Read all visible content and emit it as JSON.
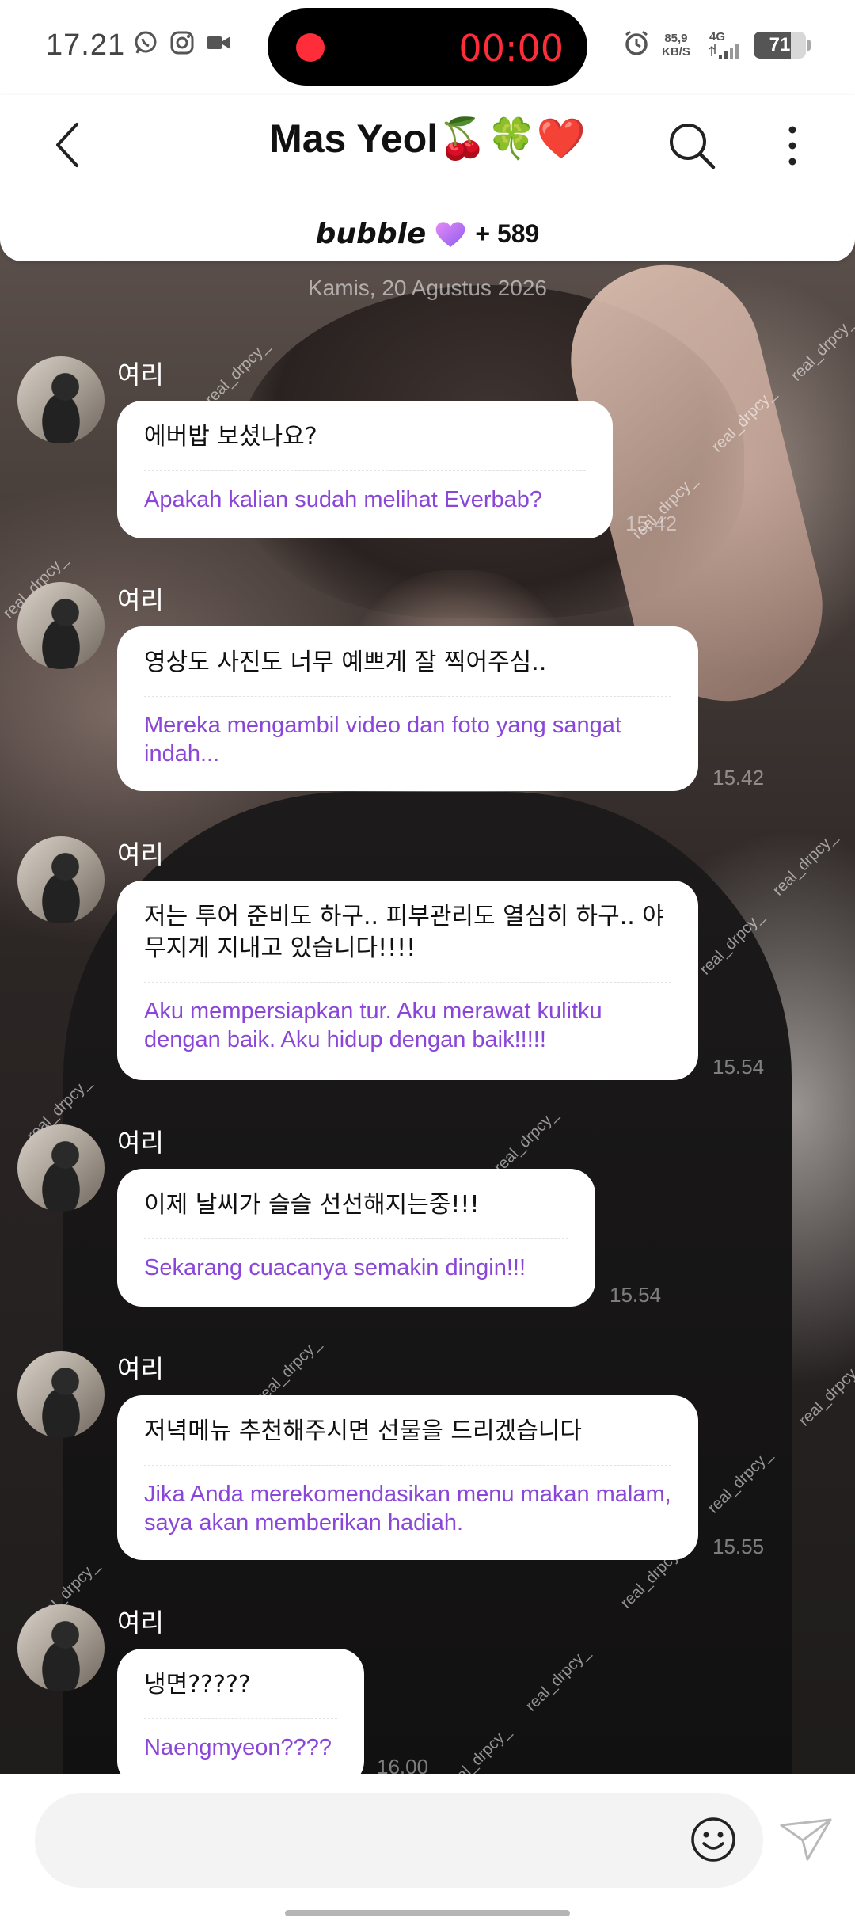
{
  "status_bar": {
    "time": "17.21",
    "record_time": "00:00",
    "net_speed_value": "85,9",
    "net_speed_unit": "KB/S",
    "signal": "4G",
    "battery": "71"
  },
  "header": {
    "title": "Mas Yeol🍒🍀❤️",
    "bubble_label": "bubble",
    "bubble_count": "+ 589"
  },
  "chat": {
    "date": "Kamis, 20 Agustus 2026",
    "messages": [
      {
        "sender": "여리",
        "korean": "에버밥 보셨나요?",
        "translation": "Apakah kalian sudah melihat Everbab?",
        "time": "15.42"
      },
      {
        "sender": "여리",
        "korean": "영상도 사진도 너무 예쁘게 잘 찍어주심..",
        "translation": "Mereka mengambil video dan foto yang sangat indah...",
        "time": "15.42"
      },
      {
        "sender": "여리",
        "korean": "저는 투어 준비도 하구.. 피부관리도 열심히 하구.. 야무지게 지내고 있습니다!!!!",
        "translation": "Aku mempersiapkan tur. Aku merawat kulitku dengan baik. Aku hidup dengan baik!!!!!",
        "time": "15.54"
      },
      {
        "sender": "여리",
        "korean": "이제 날씨가 슬슬 선선해지는중!!!",
        "translation": "Sekarang cuacanya semakin dingin!!!",
        "time": "15.54"
      },
      {
        "sender": "여리",
        "korean": "저녁메뉴 추천해주시면 선물을 드리겠습니다",
        "translation": "Jika Anda merekomendasikan menu makan malam, saya akan memberikan hadiah.",
        "time": "15.55"
      },
      {
        "sender": "여리",
        "korean": "냉면?????",
        "translation": "Naengmyeon????",
        "time": "16.00"
      }
    ],
    "watermark": "real_drpcy_"
  },
  "input": {
    "placeholder": "",
    "value": ""
  },
  "colors": {
    "translation": "#8a46d8",
    "record": "#ff2d3a",
    "bubble_heart": "#b36cf2"
  },
  "icons": {
    "back": "chevron-left-icon",
    "search": "search-icon",
    "more": "more-vertical-icon",
    "emoji": "smiley-icon",
    "send": "paper-plane-icon"
  }
}
